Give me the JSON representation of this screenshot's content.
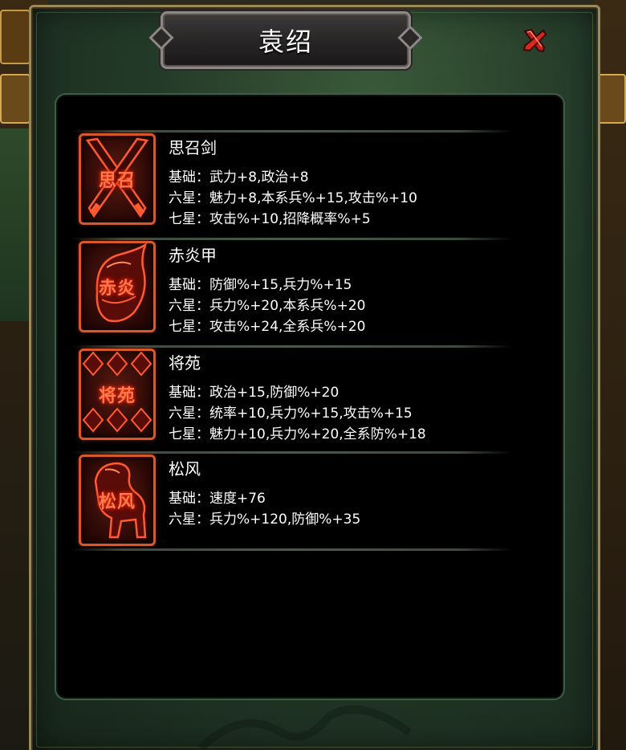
{
  "dialog": {
    "title": "袁绍",
    "close_icon": "close-x-icon"
  },
  "colors": {
    "panel_bg": "#000000",
    "frame_green": "#243a28",
    "icon_border": "#d8582c",
    "icon_glow": "#ff7a4a"
  },
  "items": [
    {
      "name": "思召剑",
      "icon": "crossed-swords-icon",
      "icon_text": "思召",
      "stats": [
        {
          "key": "基础：",
          "value": "武力+8,政治+8"
        },
        {
          "key": "六星：",
          "value": "魅力+8,本系兵%+15,攻击%+10"
        },
        {
          "key": "七星：",
          "value": "攻击%+10,招降概率%+5"
        }
      ]
    },
    {
      "name": "赤炎甲",
      "icon": "helmet-armor-icon",
      "icon_text": "赤炎",
      "stats": [
        {
          "key": "基础：",
          "value": "防御%+15,兵力%+15"
        },
        {
          "key": "六星：",
          "value": "兵力%+20,本系兵%+20"
        },
        {
          "key": "七星：",
          "value": "攻击%+24,全系兵%+20"
        }
      ]
    },
    {
      "name": "将苑",
      "icon": "book-diamond-icon",
      "icon_text": "将苑",
      "stats": [
        {
          "key": "基础：",
          "value": "政治+15,防御%+20"
        },
        {
          "key": "六星：",
          "value": "统率+10,兵力%+15,攻击%+15"
        },
        {
          "key": "七星：",
          "value": "魅力+10,兵力%+20,全系防%+18"
        }
      ]
    },
    {
      "name": "松风",
      "icon": "horse-icon",
      "icon_text": "松风",
      "stats": [
        {
          "key": "基础：",
          "value": "速度+76"
        },
        {
          "key": "六星：",
          "value": "兵力%+120,防御%+35"
        }
      ]
    }
  ]
}
